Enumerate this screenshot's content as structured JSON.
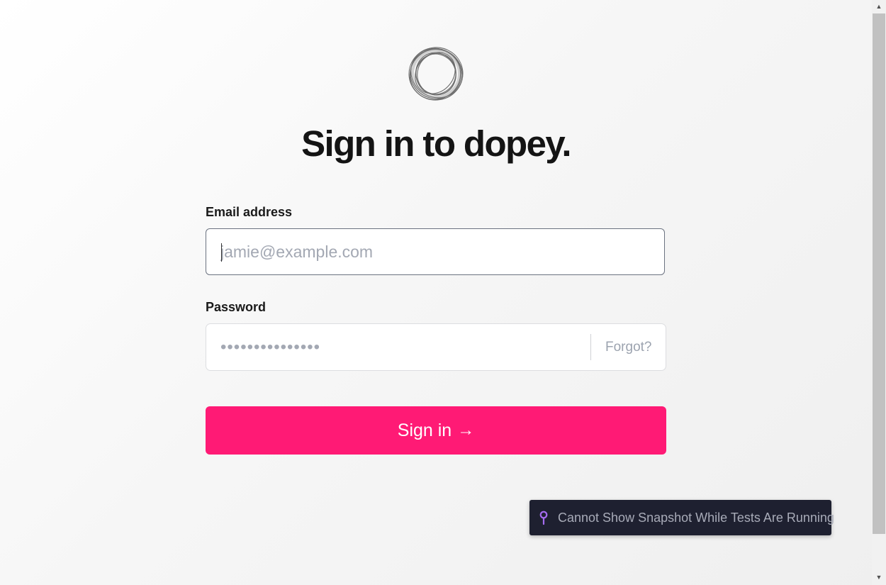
{
  "logo": {
    "icon": "ring-logo-icon"
  },
  "heading": {
    "title": "Sign in to dopey."
  },
  "email": {
    "label": "Email address",
    "placeholder": "jamie@example.com",
    "value": ""
  },
  "password": {
    "label": "Password",
    "placeholder": "•••••••••••••••",
    "forgot_label": "Forgot?"
  },
  "signin": {
    "label": "Sign in",
    "arrow": "→",
    "color": "#ff1a75"
  },
  "toast": {
    "icon": "pin-icon",
    "text": "Cannot Show Snapshot While Tests Are Running",
    "icon_color": "#a56cf0"
  },
  "scrollbar": {
    "up_arrow": "▲",
    "down_arrow": "▼"
  }
}
